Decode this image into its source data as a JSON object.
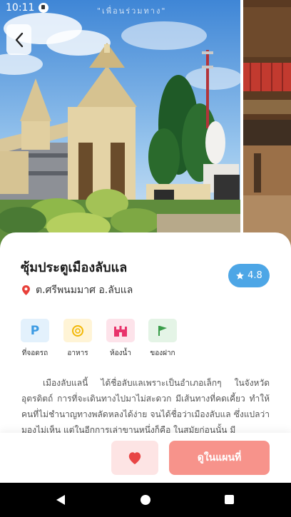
{
  "status": {
    "time": "10:11",
    "watermark": "\"เพื่อนร่วมทาง\""
  },
  "place": {
    "title": "ซุ้มประตูเมืองลับแล",
    "location": "ต.ศรีพนมมาศ อ.ลับแล",
    "rating": "4.8"
  },
  "amenities": [
    {
      "label": "ที่จอดรถ",
      "icon": "parking-icon",
      "bg": "#e3f1fc",
      "color": "#3d9be3"
    },
    {
      "label": "อาหาร",
      "icon": "food-icon",
      "bg": "#fff4d6",
      "color": "#f2b705"
    },
    {
      "label": "ห้องน้ำ",
      "icon": "toilet-icon",
      "bg": "#fde3ea",
      "color": "#e8336b"
    },
    {
      "label": "ของฝาก",
      "icon": "souvenir-flag-icon",
      "bg": "#e4f4e6",
      "color": "#3a9d4a"
    }
  ],
  "description": "เมืองลับแลนี้ ได้ชื่อลับแลเพราะเป็นอำเภอเล็กๆ ในจังหวัดอุตรดิตถ์ การที่จะเดินทางไปมาไม่สะดวก มีเส้นทางที่คดเคี้ยว ทำให้คนที่ไม่ชำนาญทางพลัดหลงได้ง่าย จนได้ชื่อว่าเมืองลับแล ซึ่งแปลว่ามองไม่เห็น แต่ในอีกการเล่าขานหนึ่งก็คือ ในสมัยก่อนนั้น มี",
  "actions": {
    "map_label": "ดูในแผนที่"
  },
  "colors": {
    "accent": "#f7938b",
    "rating": "#4da6e6",
    "pin": "#e8403a"
  }
}
